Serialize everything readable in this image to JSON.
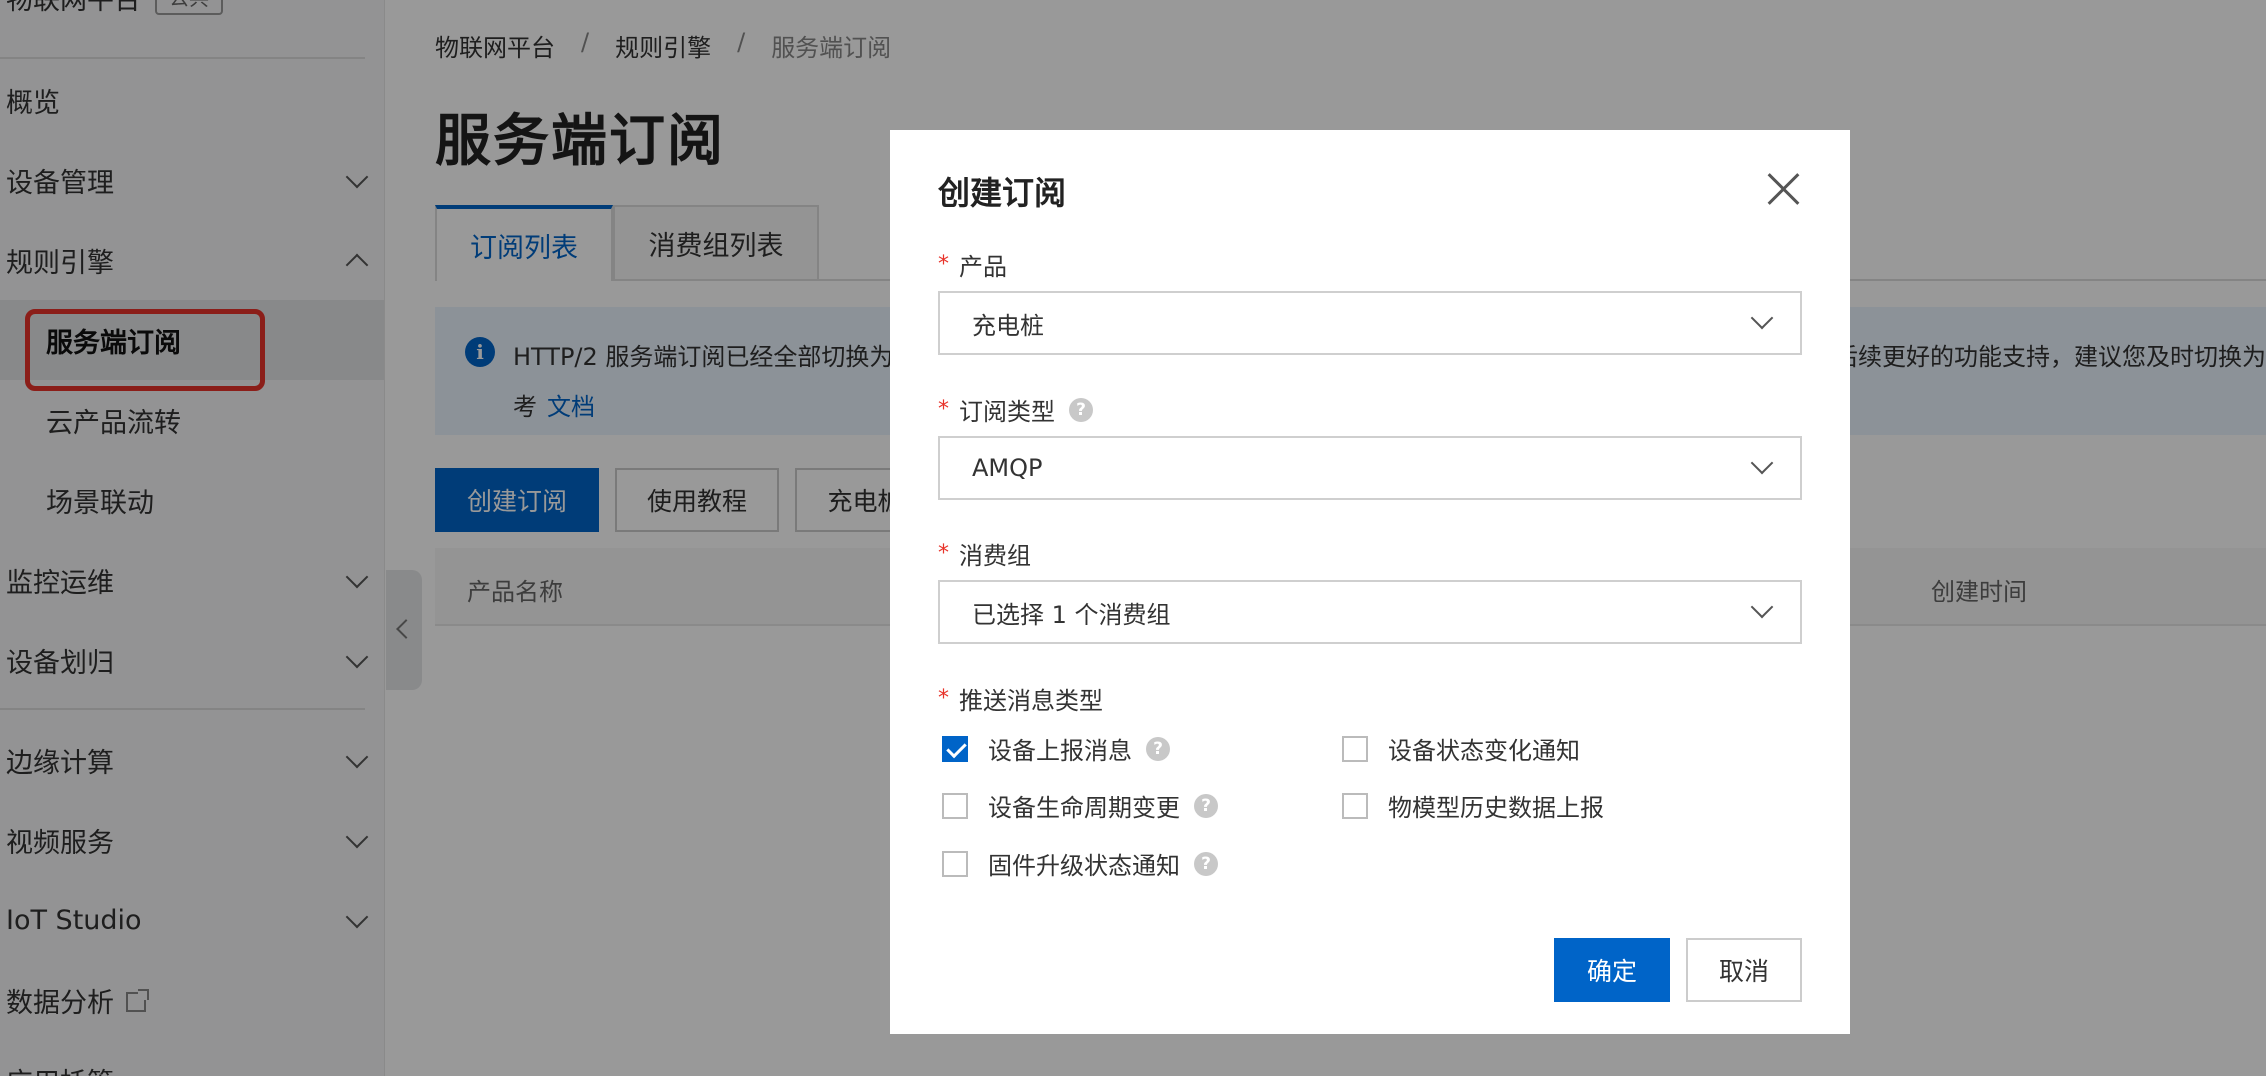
{
  "sidebar": {
    "brand": "物联网平台",
    "brand_tag": "公共",
    "items": [
      {
        "label": "概览"
      },
      {
        "label": "设备管理"
      },
      {
        "label": "规则引擎"
      },
      {
        "label": "服务端订阅"
      },
      {
        "label": "云产品流转"
      },
      {
        "label": "场景联动"
      },
      {
        "label": "监控运维"
      },
      {
        "label": "设备划归"
      },
      {
        "label": "边缘计算"
      },
      {
        "label": "视频服务"
      },
      {
        "label": "IoT Studio"
      },
      {
        "label": "数据分析"
      },
      {
        "label": "应用托管"
      }
    ]
  },
  "breadcrumb": [
    "物联网平台",
    "规则引擎",
    "服务端订阅"
  ],
  "breadcrumb_sep": "/",
  "page_title": "服务端订阅",
  "tabs": [
    "订阅列表",
    "消费组列表"
  ],
  "notice": {
    "line1_start": "HTTP/2 服务端订阅已经全部切换为",
    "line1_end": "后续更好的功能支持，建议您及时切换为",
    "line2_prefix": "考",
    "link": "文档"
  },
  "toolbar": {
    "create": "创建订阅",
    "tutorial": "使用教程",
    "filter": "充电桩"
  },
  "table": {
    "col_product": "产品名称",
    "col_created": "创建时间"
  },
  "modal": {
    "title": "创建订阅",
    "required_mark": "*",
    "help_glyph": "?",
    "product_label": "产品",
    "product_value": "充电桩",
    "type_label": "订阅类型",
    "type_value": "AMQP",
    "group_label": "消费组",
    "group_value": "已选择 1 个消费组",
    "push_label": "推送消息类型",
    "checkboxes": [
      {
        "label": "设备上报消息",
        "checked": true
      },
      {
        "label": "设备状态变化通知",
        "checked": false
      },
      {
        "label": "设备生命周期变更",
        "checked": false
      },
      {
        "label": "物模型历史数据上报",
        "checked": false
      },
      {
        "label": "固件升级状态通知",
        "checked": false
      }
    ],
    "ok": "确定",
    "cancel": "取消"
  },
  "colors": {
    "primary": "#0064c8",
    "highlight": "#e8332a"
  }
}
